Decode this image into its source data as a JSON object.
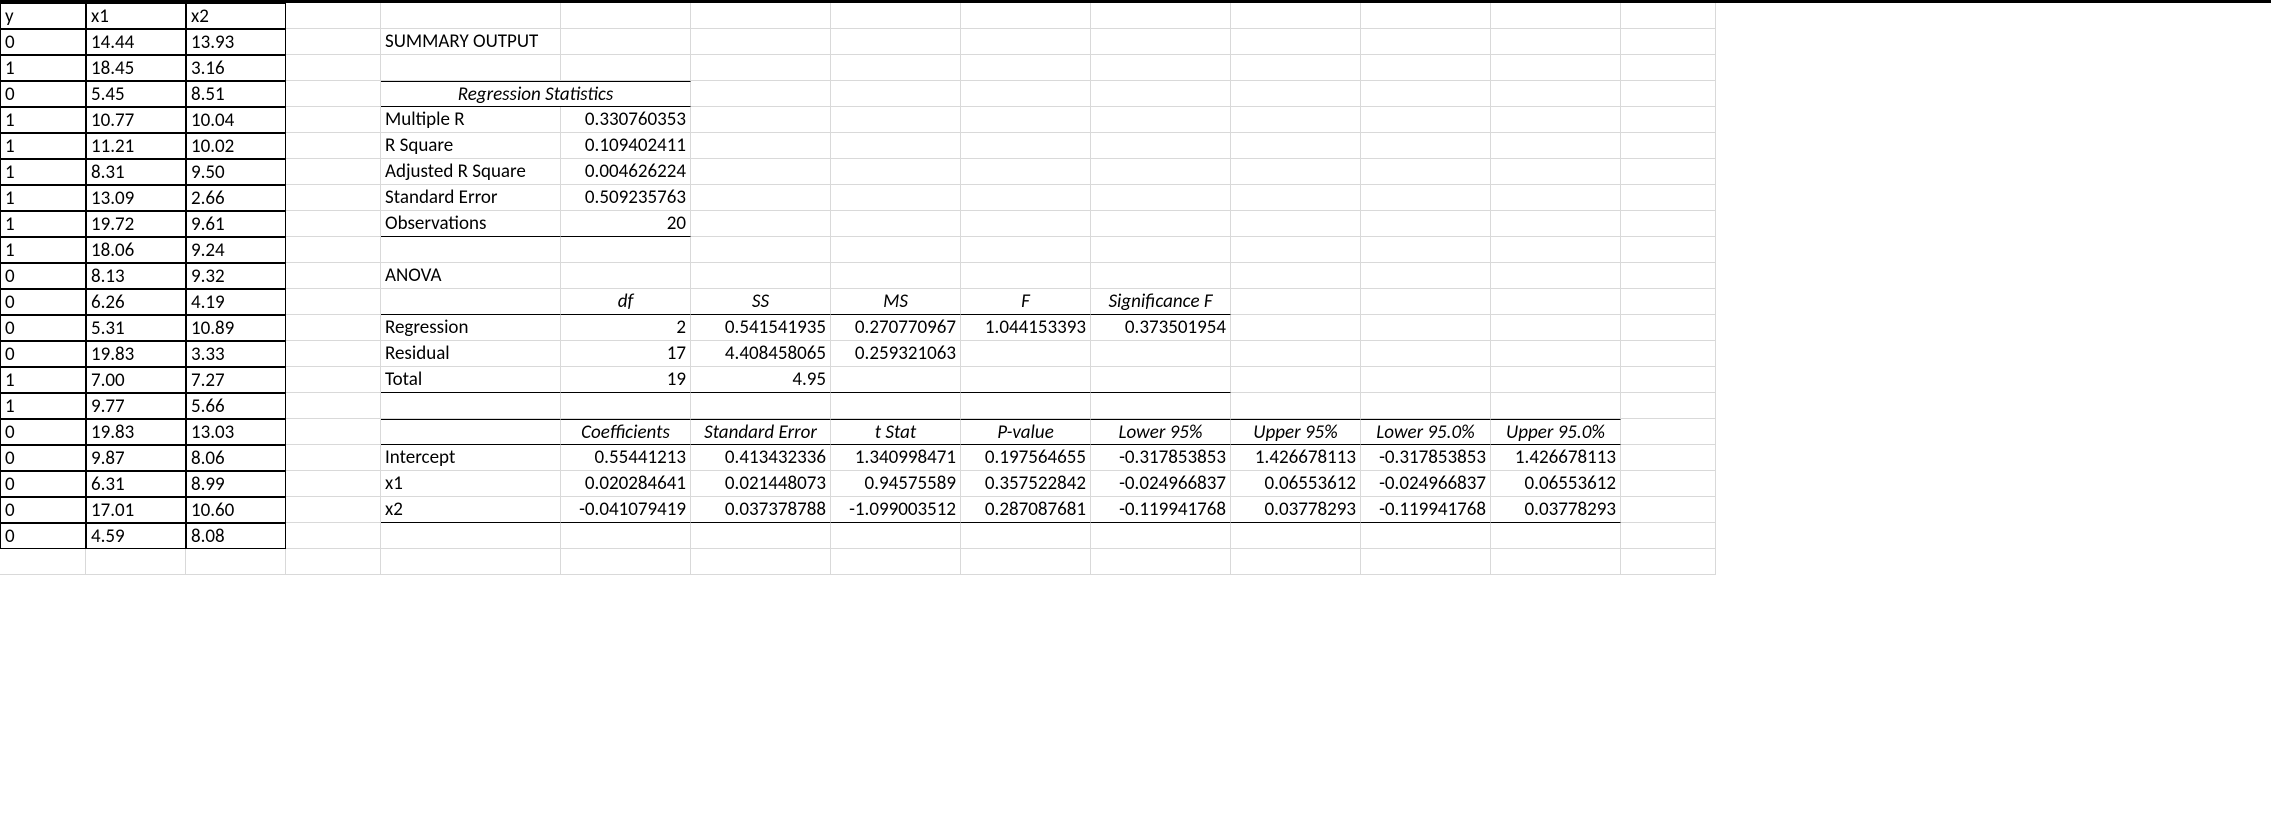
{
  "raw": {
    "headers": [
      "y",
      "x1",
      "x2"
    ],
    "rows": [
      [
        "0",
        "14.44",
        "13.93"
      ],
      [
        "1",
        "18.45",
        "3.16"
      ],
      [
        "0",
        "5.45",
        "8.51"
      ],
      [
        "1",
        "10.77",
        "10.04"
      ],
      [
        "1",
        "11.21",
        "10.02"
      ],
      [
        "1",
        "8.31",
        "9.50"
      ],
      [
        "1",
        "13.09",
        "2.66"
      ],
      [
        "1",
        "19.72",
        "9.61"
      ],
      [
        "1",
        "18.06",
        "9.24"
      ],
      [
        "0",
        "8.13",
        "9.32"
      ],
      [
        "0",
        "6.26",
        "4.19"
      ],
      [
        "0",
        "5.31",
        "10.89"
      ],
      [
        "0",
        "19.83",
        "3.33"
      ],
      [
        "1",
        "7.00",
        "7.27"
      ],
      [
        "1",
        "9.77",
        "5.66"
      ],
      [
        "0",
        "19.83",
        "13.03"
      ],
      [
        "0",
        "9.87",
        "8.06"
      ],
      [
        "0",
        "6.31",
        "8.99"
      ],
      [
        "0",
        "17.01",
        "10.60"
      ],
      [
        "0",
        "4.59",
        "8.08"
      ]
    ]
  },
  "summary": {
    "title": "SUMMARY OUTPUT",
    "stats_title": "Regression Statistics",
    "stats": [
      {
        "label": "Multiple R",
        "value": "0.330760353"
      },
      {
        "label": "R Square",
        "value": "0.109402411"
      },
      {
        "label": "Adjusted R Square",
        "value": "0.004626224"
      },
      {
        "label": "Standard Error",
        "value": "0.509235763"
      },
      {
        "label": "Observations",
        "value": "20"
      }
    ]
  },
  "anova": {
    "title": "ANOVA",
    "headers": [
      "",
      "df",
      "SS",
      "MS",
      "F",
      "Significance F"
    ],
    "rows": [
      {
        "label": "Regression",
        "vals": [
          "2",
          "0.541541935",
          "0.270770967",
          "1.044153393",
          "0.373501954"
        ]
      },
      {
        "label": "Residual",
        "vals": [
          "17",
          "4.408458065",
          "0.259321063",
          "",
          ""
        ]
      },
      {
        "label": "Total",
        "vals": [
          "19",
          "4.95",
          "",
          "",
          ""
        ]
      }
    ]
  },
  "coef": {
    "headers": [
      "",
      "Coefficients",
      "Standard Error",
      "t Stat",
      "P-value",
      "Lower 95%",
      "Upper 95%",
      "Lower 95.0%",
      "Upper 95.0%"
    ],
    "rows": [
      {
        "label": "Intercept",
        "vals": [
          "0.55441213",
          "0.413432336",
          "1.340998471",
          "0.197564655",
          "-0.317853853",
          "1.426678113",
          "-0.317853853",
          "1.426678113"
        ]
      },
      {
        "label": "x1",
        "vals": [
          "0.020284641",
          "0.021448073",
          "0.94575589",
          "0.357522842",
          "-0.024966837",
          "0.06553612",
          "-0.024966837",
          "0.06553612"
        ]
      },
      {
        "label": "x2",
        "vals": [
          "-0.041079419",
          "0.037378788",
          "-1.099003512",
          "0.287087681",
          "-0.119941768",
          "0.03778293",
          "-0.119941768",
          "0.03778293"
        ]
      }
    ]
  }
}
